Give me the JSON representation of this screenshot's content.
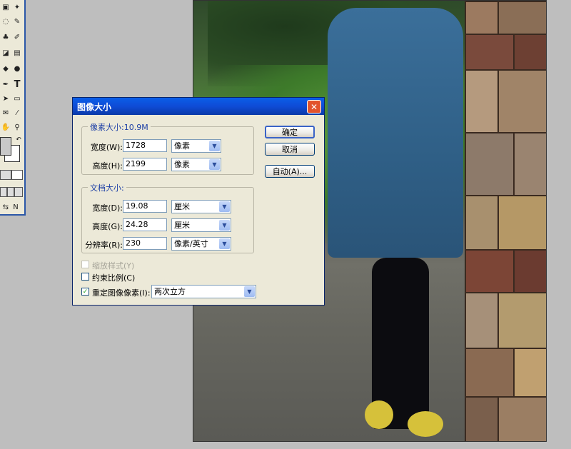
{
  "dialog": {
    "title": "图像大小",
    "pixel_dimensions": {
      "legend": "像素大小:10.9M",
      "width_label": "宽度(W):",
      "width_value": "1728",
      "width_unit": "像素",
      "height_label": "高度(H):",
      "height_value": "2199",
      "height_unit": "像素"
    },
    "document_size": {
      "legend": "文档大小:",
      "width_label": "宽度(D):",
      "width_value": "19.08",
      "width_unit": "厘米",
      "height_label": "高度(G):",
      "height_value": "24.28",
      "height_unit": "厘米",
      "resolution_label": "分辨率(R):",
      "resolution_value": "230",
      "resolution_unit": "像素/英寸"
    },
    "scale_styles": {
      "label": "缩放样式(Y)",
      "checked": false,
      "enabled": false
    },
    "constrain": {
      "label": "约束比例(C)",
      "checked": false
    },
    "resample": {
      "label": "重定图像像素(I):",
      "checked": true,
      "method": "两次立方"
    },
    "buttons": {
      "ok": "确定",
      "cancel": "取消",
      "auto": "自动(A)..."
    }
  },
  "tools": {
    "icons": [
      "move-icon",
      "lasso-icon",
      "magic-wand-icon",
      "crop-icon",
      "brush-icon",
      "eraser-icon",
      "gradient-icon",
      "dodge-icon",
      "pen-icon",
      "type-icon",
      "path-select-icon",
      "rectangle-icon",
      "notes-icon",
      "eyedropper-icon",
      "hand-icon",
      "zoom-icon"
    ],
    "type_glyph": "T"
  }
}
